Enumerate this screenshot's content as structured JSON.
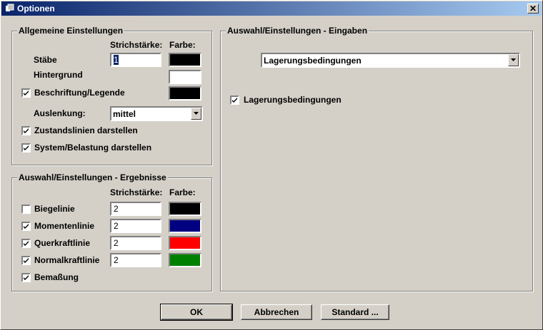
{
  "window": {
    "title": "Optionen",
    "close_label": "✕"
  },
  "general": {
    "title": "Allgemeine Einstellungen",
    "col_stroke": "Strichstärke:",
    "col_color": "Farbe:",
    "rows": {
      "staebe": {
        "label": "Stäbe",
        "stroke": "1",
        "color": "#000000"
      },
      "hintergrund": {
        "label": "Hintergrund",
        "color": "#ffffff"
      },
      "beschriftung": {
        "label": "Beschriftung/Legende",
        "checked": true,
        "color": "#000000"
      }
    },
    "auslenkung": {
      "label": "Auslenkung:",
      "value": "mittel"
    },
    "zustandslinien": {
      "label": "Zustandslinien darstellen",
      "checked": true
    },
    "system": {
      "label": "System/Belastung darstellen",
      "checked": true
    }
  },
  "results": {
    "title": "Auswahl/Einstellungen - Ergebnisse",
    "col_stroke": "Strichstärke:",
    "col_color": "Farbe:",
    "rows": [
      {
        "label": "Biegelinie",
        "checked": false,
        "stroke": "2",
        "color": "#000000"
      },
      {
        "label": "Momentenlinie",
        "checked": true,
        "stroke": "2",
        "color": "#000080"
      },
      {
        "label": "Querkraftlinie",
        "checked": true,
        "stroke": "2",
        "color": "#ff0000"
      },
      {
        "label": "Normalkraftlinie",
        "checked": true,
        "stroke": "2",
        "color": "#008000"
      }
    ],
    "bemassung": {
      "label": "Bemaßung",
      "checked": true
    }
  },
  "inputs": {
    "title": "Auswahl/Einstellungen - Eingaben",
    "dropdown_value": "Lagerungsbedingungen",
    "checkbox": {
      "label": "Lagerungsbedingungen",
      "checked": true
    }
  },
  "buttons": {
    "ok": "OK",
    "cancel": "Abbrechen",
    "standard": "Standard ..."
  }
}
